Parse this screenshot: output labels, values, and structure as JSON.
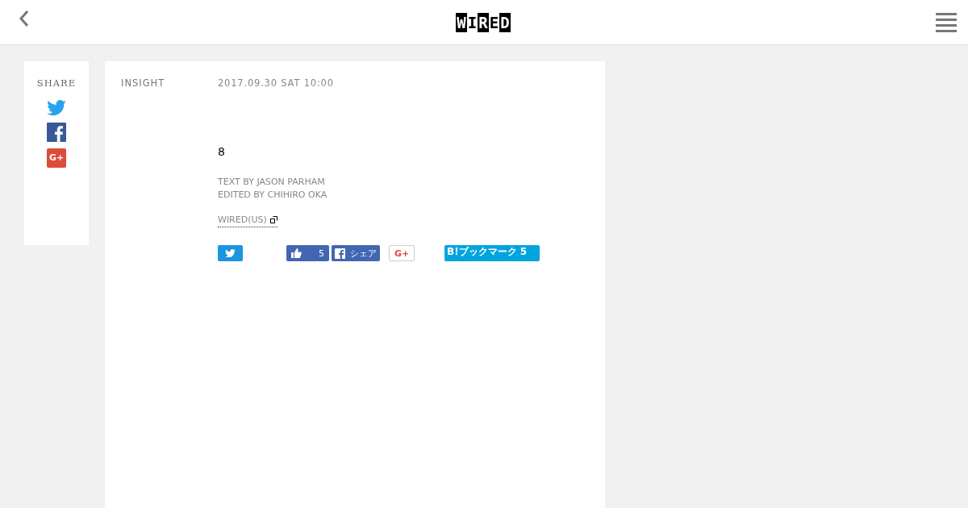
{
  "header": {
    "logo": "WIRED"
  },
  "share": {
    "label": "SHARE",
    "icons": [
      {
        "kind": "twitter"
      },
      {
        "kind": "facebook"
      },
      {
        "kind": "gplus",
        "label": "G+"
      }
    ]
  },
  "article": {
    "category": "INSIGHT",
    "date": "2017.09.30 SAT 10:00",
    "title": "8",
    "credits": [
      "TEXT BY JASON PARHAM",
      "EDITED BY CHIHIRO OKA"
    ],
    "source_link": "WIRED(US)"
  },
  "social_buttons": [
    {
      "kind": "tweet"
    },
    {
      "kind": "like",
      "count": "5"
    },
    {
      "kind": "fb-share",
      "label": "シェア"
    },
    {
      "kind": "gplus",
      "label": "G+"
    },
    {
      "kind": "hatena",
      "label": "B!ブックマーク 5"
    }
  ]
}
